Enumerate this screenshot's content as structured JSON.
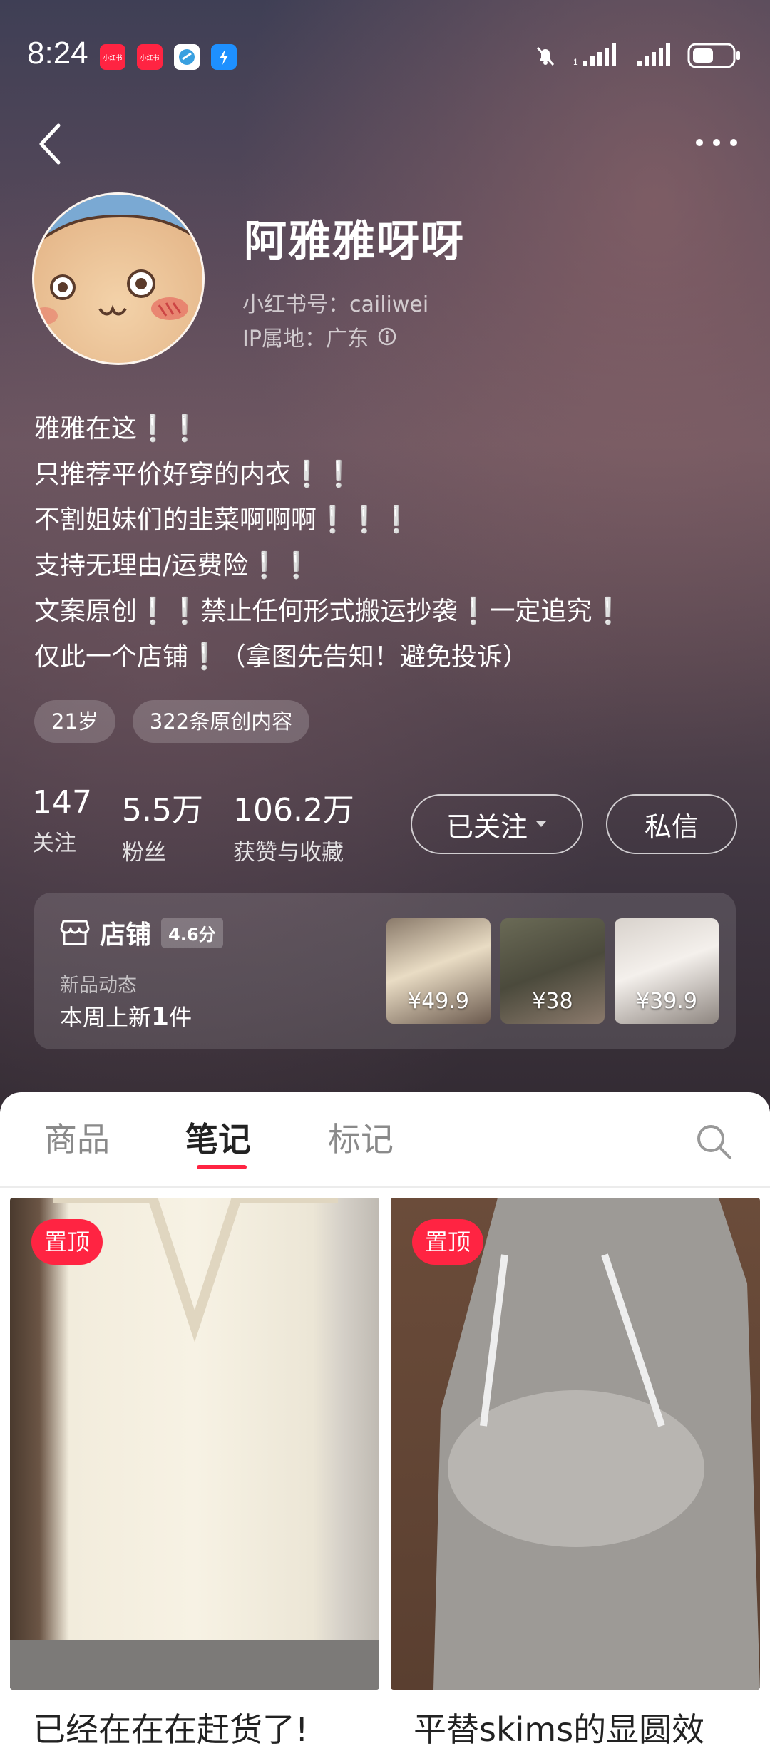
{
  "status_bar": {
    "time": "8:24",
    "notif_apps": [
      "小红书",
      "小红书"
    ]
  },
  "nav": {
    "back_icon": "chevron-left-icon",
    "more_icon": "more-dots-icon"
  },
  "profile": {
    "name": "阿雅雅呀呀",
    "id_line": "小红书号：cailiwei",
    "ip_line": "IP属地：广东",
    "bio": [
      "雅雅在这❕❕",
      "只推荐平价好穿的内衣❕❕",
      "不割姐妹们的韭菜啊啊啊❕❕❕",
      "支持无理由/运费险❕❕",
      "文案原创❕❕禁止任何形式搬运抄袭❕一定追究❕",
      "仅此一个店铺❕（拿图先告知！避免投诉）"
    ],
    "tags": [
      "21岁",
      "322条原创内容"
    ]
  },
  "stats": [
    {
      "num": "147",
      "label": "关注"
    },
    {
      "num": "5.5万",
      "label": "粉丝"
    },
    {
      "num": "106.2万",
      "label": "获赞与收藏"
    }
  ],
  "actions": {
    "follow_label": "已关注",
    "message_label": "私信"
  },
  "shop": {
    "title": "店铺",
    "score": "4.6分",
    "sub_label": "新品动态",
    "new_prefix": "本周上新",
    "new_count": "1",
    "new_suffix": "件",
    "thumbs": [
      {
        "price": "¥49.9",
        "color": "#6b5a4e"
      },
      {
        "price": "¥38",
        "color": "#4b4a3c"
      },
      {
        "price": "¥39.9",
        "color": "#b9b2ad"
      }
    ]
  },
  "tabs": {
    "items": [
      "商品",
      "笔记",
      "标记"
    ],
    "active": 1
  },
  "notes": [
    {
      "pin": "置顶",
      "title": "已经在在在赶货了!"
    },
    {
      "pin": "置顶",
      "title": "平替skims的显圆效"
    }
  ],
  "colors": {
    "accent": "#ff2442"
  }
}
